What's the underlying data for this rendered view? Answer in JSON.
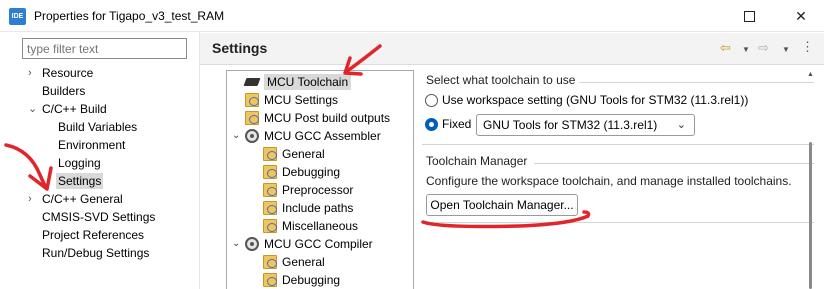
{
  "window": {
    "app_icon_text": "IDE",
    "title": "Properties for Tigapo_v3_test_RAM"
  },
  "filter": {
    "placeholder": "type filter text"
  },
  "nav": {
    "items": [
      {
        "label": "Resource",
        "expandable": true
      },
      {
        "label": "Builders"
      },
      {
        "label": "C/C++ Build",
        "expanded": true
      },
      {
        "label": "Build Variables"
      },
      {
        "label": "Environment"
      },
      {
        "label": "Logging"
      },
      {
        "label": "Settings",
        "selected": true
      },
      {
        "label": "C/C++ General",
        "expandable": true
      },
      {
        "label": "CMSIS-SVD Settings"
      },
      {
        "label": "Project References"
      },
      {
        "label": "Run/Debug Settings"
      }
    ]
  },
  "header": {
    "title": "Settings"
  },
  "tree": {
    "items": [
      {
        "label": "MCU Toolchain",
        "icon": "chip-icon",
        "selected": true
      },
      {
        "label": "MCU Settings",
        "icon": "folder-settings-icon"
      },
      {
        "label": "MCU Post build outputs",
        "icon": "folder-settings-icon"
      },
      {
        "label": "MCU GCC Assembler",
        "icon": "gear-icon",
        "expanded": true
      },
      {
        "label": "General",
        "icon": "folder-settings-icon"
      },
      {
        "label": "Debugging",
        "icon": "folder-settings-icon"
      },
      {
        "label": "Preprocessor",
        "icon": "folder-settings-icon"
      },
      {
        "label": "Include paths",
        "icon": "folder-settings-icon"
      },
      {
        "label": "Miscellaneous",
        "icon": "folder-settings-icon"
      },
      {
        "label": "MCU GCC Compiler",
        "icon": "gear-icon",
        "expanded": true
      },
      {
        "label": "General",
        "icon": "folder-settings-icon"
      },
      {
        "label": "Debugging",
        "icon": "folder-settings-icon"
      }
    ]
  },
  "toolchain": {
    "group_title": "Select what toolchain to use",
    "workspace_option": "Use workspace setting (GNU Tools for STM32 (11.3.rel1))",
    "fixed_option": "Fixed",
    "selected_option": "Fixed",
    "fixed_value": "GNU Tools for STM32 (11.3.rel1)"
  },
  "manager": {
    "group_title": "Toolchain Manager",
    "description": "Configure the workspace toolchain, and manage installed toolchains.",
    "button_label": "Open Toolchain Manager..."
  },
  "colors": {
    "annotation": "#e0262a",
    "radio_checked": "#005fb8",
    "selection": "#d9d9d9"
  }
}
